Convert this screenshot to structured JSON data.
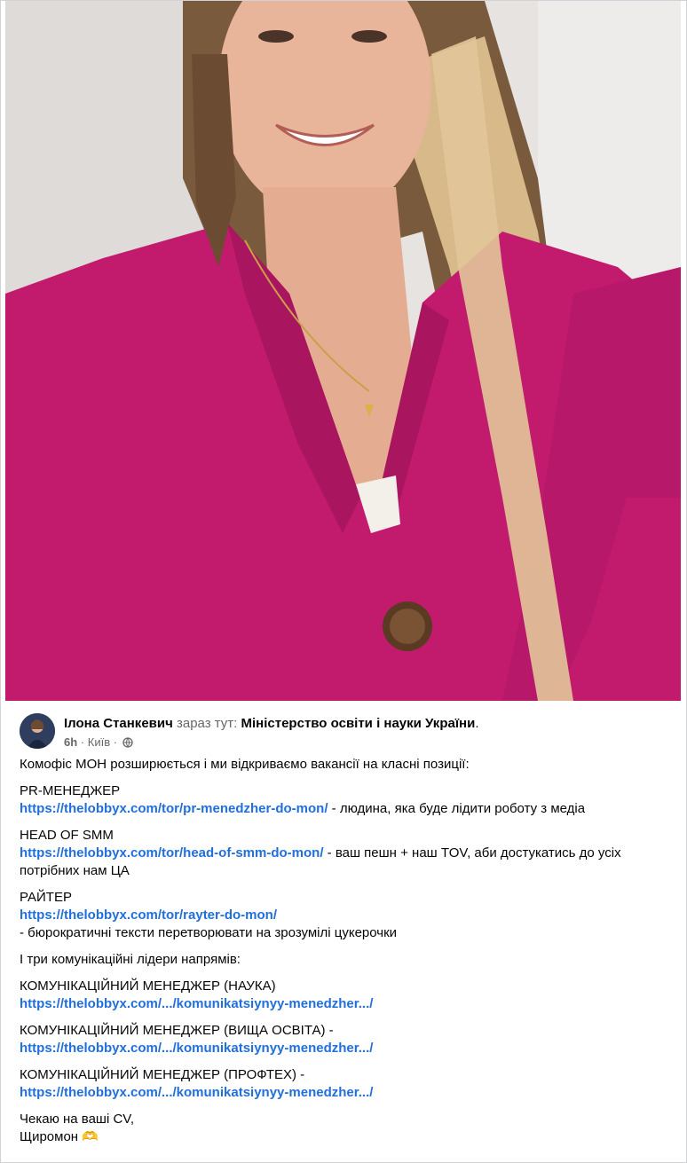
{
  "post": {
    "author": "Ілона Станкевич",
    "location_prefix": "зараз тут:",
    "location": "Міністерство освіти і науки України",
    "location_suffix": ".",
    "time": "6h",
    "separator": "·",
    "city": "Київ",
    "separator2": "·",
    "intro": "Комофіс МОН розширюється і ми відкриваємо вакансії на класні позиції:",
    "jobs": [
      {
        "title": "PR-МЕНЕДЖЕР",
        "link": "https://thelobbyx.com/tor/pr-menedzher-do-mon/",
        "desc": " - людина, яка буде лідити роботу з медіа"
      },
      {
        "title": "HEAD OF SMM",
        "link": "https://thelobbyx.com/tor/head-of-smm-do-mon/",
        "desc": " - ваш пешн + наш TOV, аби достукатись до усіх потрібних нам ЦА"
      },
      {
        "title": "РАЙТЕР",
        "link": "https://thelobbyx.com/tor/rayter-do-mon/",
        "desc": "- бюрократичні тексти перетворювати на зрозумілі цукерочки"
      }
    ],
    "leaders_intro": "І три комунікаційні лідери напрямів:",
    "leaders": [
      {
        "title": "КОМУНІКАЦІЙНИЙ МЕНЕДЖЕР (НАУКА)",
        "link": "https://thelobbyx.com/.../komunikatsiynyy-menedzher.../"
      },
      {
        "title": "КОМУНІКАЦІЙНИЙ МЕНЕДЖЕР (ВИЩА ОСВІТА) -",
        "link": "https://thelobbyx.com/.../komunikatsiynyy-menedzher.../"
      },
      {
        "title": "КОМУНІКАЦІЙНИЙ МЕНЕДЖЕР (ПРОФТЕХ) -",
        "link": "https://thelobbyx.com/.../komunikatsiynyy-menedzher.../"
      }
    ],
    "closing_line1": "Чекаю на ваші CV,",
    "closing_line2": "Щиромон",
    "closing_emoji": "🫶"
  },
  "colors": {
    "link": "#216fdb",
    "muted": "#65676b",
    "sweater": "#c21b6e"
  },
  "icons": {
    "globe": "globe-icon",
    "pendant": "trident-pendant"
  }
}
